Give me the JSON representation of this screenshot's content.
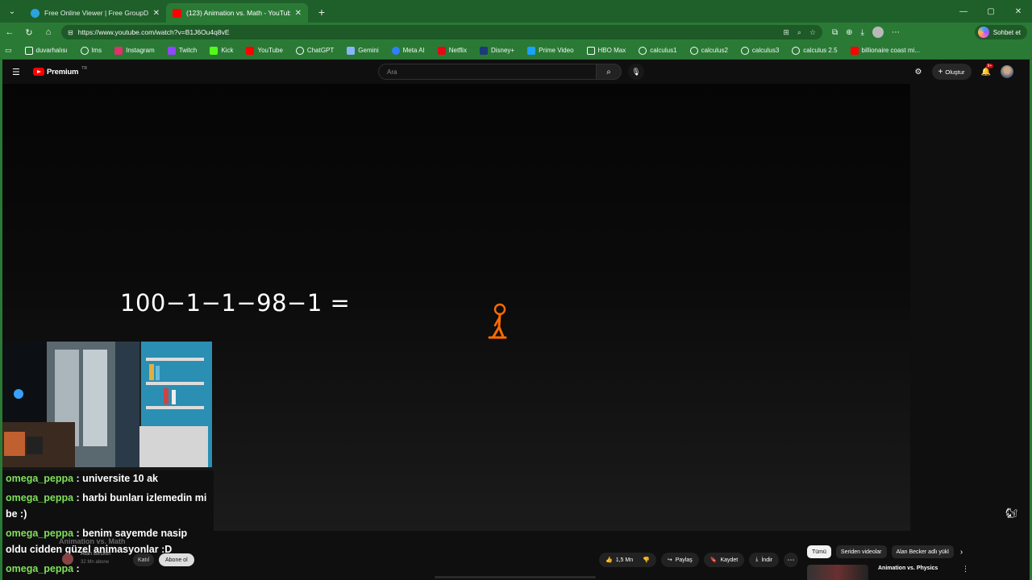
{
  "browser": {
    "tabs": [
      {
        "title": "Free Online Viewer | Free GroupDocs",
        "active": false,
        "close": "✕"
      },
      {
        "title": "(123) Animation vs. Math - YouTube",
        "active": true,
        "close": "✕"
      }
    ],
    "new_tab": "+",
    "window_controls": {
      "minimize": "—",
      "maximize": "▢",
      "close": "✕"
    },
    "url": "https://www.youtube.com/watch?v=B1J6Ou4q8vE",
    "sohbet_label": "Sohbet et",
    "bookmarks": [
      {
        "label": "duvarhalısı",
        "icon": "person-icon",
        "color": "#ffffff"
      },
      {
        "label": "lms",
        "icon": "globe-icon",
        "color": "#ffffff"
      },
      {
        "label": "Instagram",
        "icon": "instagram-icon",
        "color": "#e1306c"
      },
      {
        "label": "Twitch",
        "icon": "twitch-icon",
        "color": "#9146ff"
      },
      {
        "label": "Kick",
        "icon": "kick-icon",
        "color": "#53fc18"
      },
      {
        "label": "YouTube",
        "icon": "youtube-icon",
        "color": "#ff0000"
      },
      {
        "label": "ChatGPT",
        "icon": "chatgpt-icon",
        "color": "#ffffff"
      },
      {
        "label": "Gemini",
        "icon": "gemini-icon",
        "color": "#8ab4f8"
      },
      {
        "label": "Meta AI",
        "icon": "meta-ai-icon",
        "color": "#2f80ff"
      },
      {
        "label": "Netflix",
        "icon": "netflix-icon",
        "color": "#e50914"
      },
      {
        "label": "Disney+",
        "icon": "disney-icon",
        "color": "#1c3a7a"
      },
      {
        "label": "Prime Video",
        "icon": "prime-video-icon",
        "color": "#1aa0ff"
      },
      {
        "label": "HBO Max",
        "icon": "hbo-max-icon",
        "color": "#ffffff"
      },
      {
        "label": "calculus1",
        "icon": "globe-icon",
        "color": "#ffffff"
      },
      {
        "label": "calculus2",
        "icon": "globe-icon",
        "color": "#ffffff"
      },
      {
        "label": "calculus3",
        "icon": "globe-icon",
        "color": "#ffffff"
      },
      {
        "label": "calculus 2.5",
        "icon": "globe-icon",
        "color": "#ffffff"
      },
      {
        "label": "billionaire coast mi...",
        "icon": "youtube-icon",
        "color": "#ff0000"
      }
    ]
  },
  "youtube": {
    "logo_text": "Premium",
    "logo_sup": "TR",
    "search_placeholder": "Ara",
    "create_label": "Oluştur",
    "notif_count": "9+",
    "video": {
      "equation": "100−1−1−98−1 ="
    },
    "below": {
      "title_faint": "Animation vs. Math",
      "channel": "Alan Becker",
      "subs": "32 Mn abone",
      "join": "Katıl",
      "subscribe": "Abone ol",
      "likes": "1,5 Mn",
      "share": "Paylaş",
      "save": "Kaydet",
      "download": "İndir",
      "chips": [
        "Tümü",
        "Seriden videolar",
        "Alan Becker adlı yükl"
      ],
      "rec_title": "Animation vs. Physics"
    }
  },
  "stream_chat": [
    {
      "user": "omega_peppa",
      "message": ": universite 10 ak"
    },
    {
      "user": "omega_peppa",
      "message": ": harbi bunları izlemedin mi be :)"
    },
    {
      "user": "omega_peppa",
      "message": ": benim sayemde nasip oldu cidden güzel animasyonlar :D"
    },
    {
      "user": "omega_peppa",
      "message": ":"
    }
  ],
  "colors": {
    "browser_accent": "#2a7a36",
    "chat_user": "#7fe05a",
    "stickman": "#ff6a00"
  }
}
